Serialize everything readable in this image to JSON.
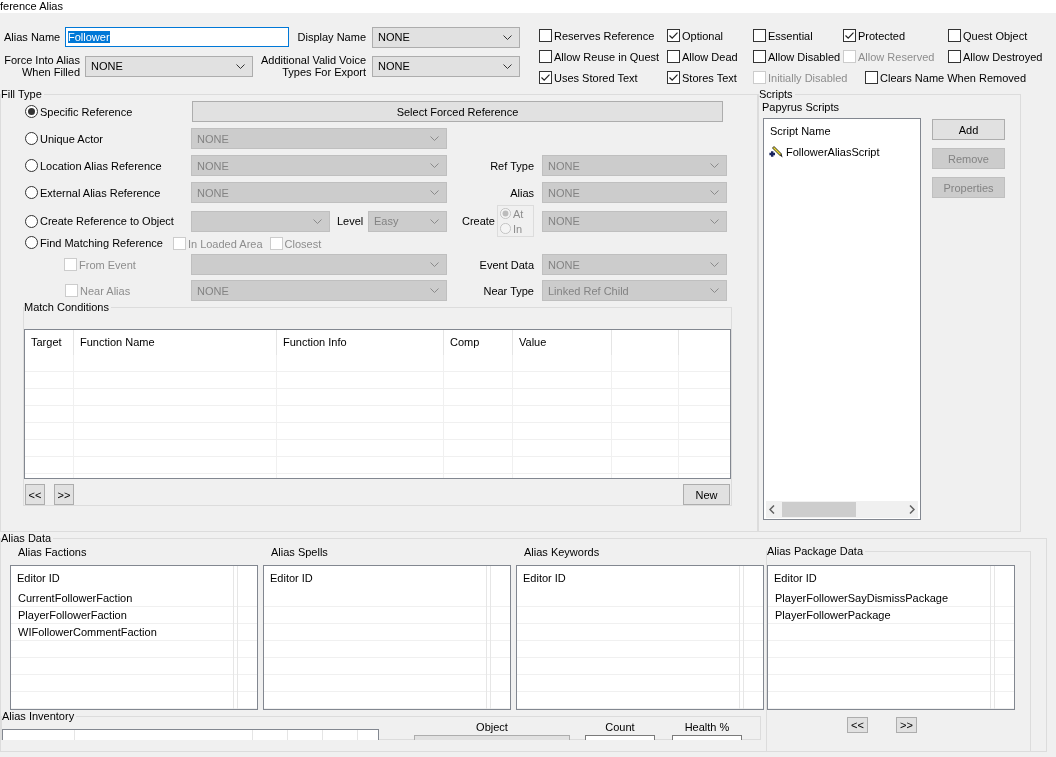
{
  "window": {
    "title": "ference Alias"
  },
  "alias_name": {
    "label": "Alias Name",
    "value": "Follower",
    "value_selected": true
  },
  "display_name": {
    "label": "Display Name",
    "value": "NONE",
    "disabled": false
  },
  "force_into_alias": {
    "label": "Force Into Alias When Filled",
    "value": "NONE",
    "disabled": false
  },
  "voice_types": {
    "label": "Additional Valid Voice Types For Export",
    "value": "NONE",
    "disabled": false
  },
  "flags": [
    [
      {
        "label": "Reserves Reference",
        "checked": false,
        "disabled": false
      },
      {
        "label": "Optional",
        "checked": true,
        "disabled": false
      },
      {
        "label": "Essential",
        "checked": false,
        "disabled": false
      },
      {
        "label": "Protected",
        "checked": true,
        "disabled": false
      },
      {
        "label": "Quest Object",
        "checked": false,
        "disabled": false
      }
    ],
    [
      {
        "label": "Allow Reuse in Quest",
        "checked": false,
        "disabled": false
      },
      {
        "label": "Allow Dead",
        "checked": false,
        "disabled": false
      },
      {
        "label": "Allow Disabled",
        "checked": false,
        "disabled": false
      },
      {
        "label": "Allow Reserved",
        "checked": false,
        "disabled": true
      },
      {
        "label": "Allow Destroyed",
        "checked": false,
        "disabled": false
      }
    ],
    [
      {
        "label": "Uses Stored Text",
        "checked": true,
        "disabled": false
      },
      {
        "label": "Stores Text",
        "checked": true,
        "disabled": false
      },
      {
        "label": "Initially Disabled",
        "checked": false,
        "disabled": true
      },
      {
        "label": "Clears Name When Removed",
        "checked": false,
        "disabled": false
      }
    ]
  ],
  "fill_type": {
    "title": "Fill Type",
    "methods": [
      {
        "label": "Specific Reference",
        "selected": true
      },
      {
        "label": "Unique Actor",
        "selected": false
      },
      {
        "label": "Location Alias Reference",
        "selected": false
      },
      {
        "label": "External Alias Reference",
        "selected": false
      },
      {
        "label": "Create Reference to Object",
        "selected": false
      },
      {
        "label": "Find Matching Reference",
        "selected": false
      }
    ],
    "select_forced_reference": "Select Forced Reference",
    "unique_actor": {
      "value": "NONE",
      "disabled": true
    },
    "location_alias": {
      "value": "NONE",
      "disabled": true
    },
    "ref_type": {
      "label": "Ref Type",
      "value": "NONE",
      "disabled": true
    },
    "external_alias": {
      "value": "NONE",
      "disabled": true
    },
    "alias": {
      "label": "Alias",
      "value": "NONE",
      "disabled": true
    },
    "object": {
      "disabled": true
    },
    "level": {
      "label": "Level",
      "value": "Easy",
      "disabled": true
    },
    "create": {
      "label": "Create",
      "disabled": true,
      "options": [
        {
          "label": "At",
          "selected": true
        },
        {
          "label": "In",
          "selected": false
        }
      ]
    },
    "create_target": {
      "value": "NONE",
      "disabled": true
    },
    "match_options": [
      {
        "label": "In Loaded Area",
        "checked": false,
        "disabled": true
      },
      {
        "label": "Closest",
        "checked": false,
        "disabled": true
      }
    ],
    "from_event": {
      "label": "From Event",
      "checked": false,
      "disabled": true
    },
    "event": {
      "disabled": true
    },
    "event_data": {
      "label": "Event Data",
      "value": "NONE",
      "disabled": true
    },
    "near_alias": {
      "label": "Near Alias",
      "checked": false,
      "disabled": true
    },
    "near_alias_target": {
      "value": "NONE",
      "disabled": true
    },
    "near_type": {
      "label": "Near Type",
      "value": "Linked Ref Child",
      "disabled": true
    },
    "match_conditions": {
      "title": "Match Conditions",
      "columns": [
        "Target",
        "Function Name",
        "Function Info",
        "Comp",
        "Value"
      ],
      "prev_button": "<<",
      "next_button": ">>",
      "new_button": "New"
    }
  },
  "scripts": {
    "title": "Scripts",
    "subtitle": "Papyrus Scripts",
    "column": "Script Name",
    "items": [
      "FollowerAliasScript"
    ],
    "buttons": [
      {
        "label": "Add",
        "disabled": false
      },
      {
        "label": "Remove",
        "disabled": true
      },
      {
        "label": "Properties",
        "disabled": true
      }
    ]
  },
  "alias_data": {
    "title": "Alias Data",
    "lists": [
      {
        "title": "Alias Factions",
        "column": "Editor ID",
        "items": [
          "CurrentFollowerFaction",
          "PlayerFollowerFaction",
          "WIFollowerCommentFaction"
        ]
      },
      {
        "title": "Alias Spells",
        "column": "Editor ID"
      },
      {
        "title": "Alias Keywords",
        "column": "Editor ID"
      }
    ],
    "package_data": {
      "title": "Alias Package Data",
      "column": "Editor ID",
      "items": [
        "PlayerFollowerSayDismissPackage",
        "PlayerFollowerPackage"
      ],
      "prev_button": "<<",
      "next_button": ">>"
    },
    "inventory": {
      "title": "Alias Inventory",
      "object_label": "Object",
      "count_label": "Count",
      "health_label": "Health %"
    }
  }
}
